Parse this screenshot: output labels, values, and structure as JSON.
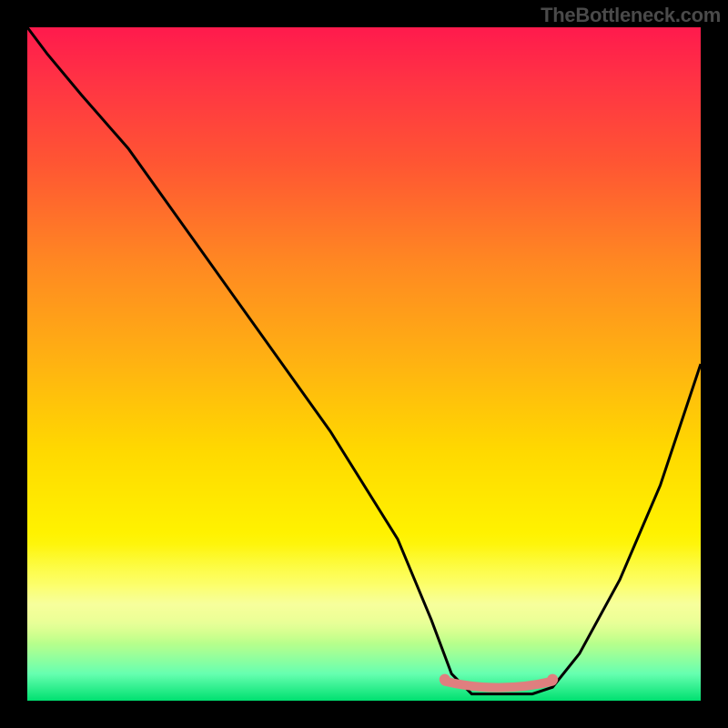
{
  "attribution": "TheBottleneck.com",
  "chart_data": {
    "type": "line",
    "title": "",
    "xlabel": "",
    "ylabel": "",
    "xlim": [
      0,
      100
    ],
    "ylim": [
      0,
      100
    ],
    "series": [
      {
        "name": "bottleneck-curve",
        "x": [
          0,
          3,
          8,
          15,
          25,
          35,
          45,
          55,
          60,
          63,
          66,
          72,
          75,
          78,
          82,
          88,
          94,
          100
        ],
        "y": [
          100,
          96,
          90,
          82,
          68,
          54,
          40,
          24,
          12,
          4,
          1,
          1,
          1,
          2,
          7,
          18,
          32,
          50
        ]
      },
      {
        "name": "optimal-band",
        "x": [
          62,
          78
        ],
        "y": [
          1,
          1
        ]
      }
    ],
    "colors": {
      "curve": "#000000",
      "band_marker": "#e08080",
      "gradient_top": "#ff1a4d",
      "gradient_bottom": "#00e070"
    }
  }
}
